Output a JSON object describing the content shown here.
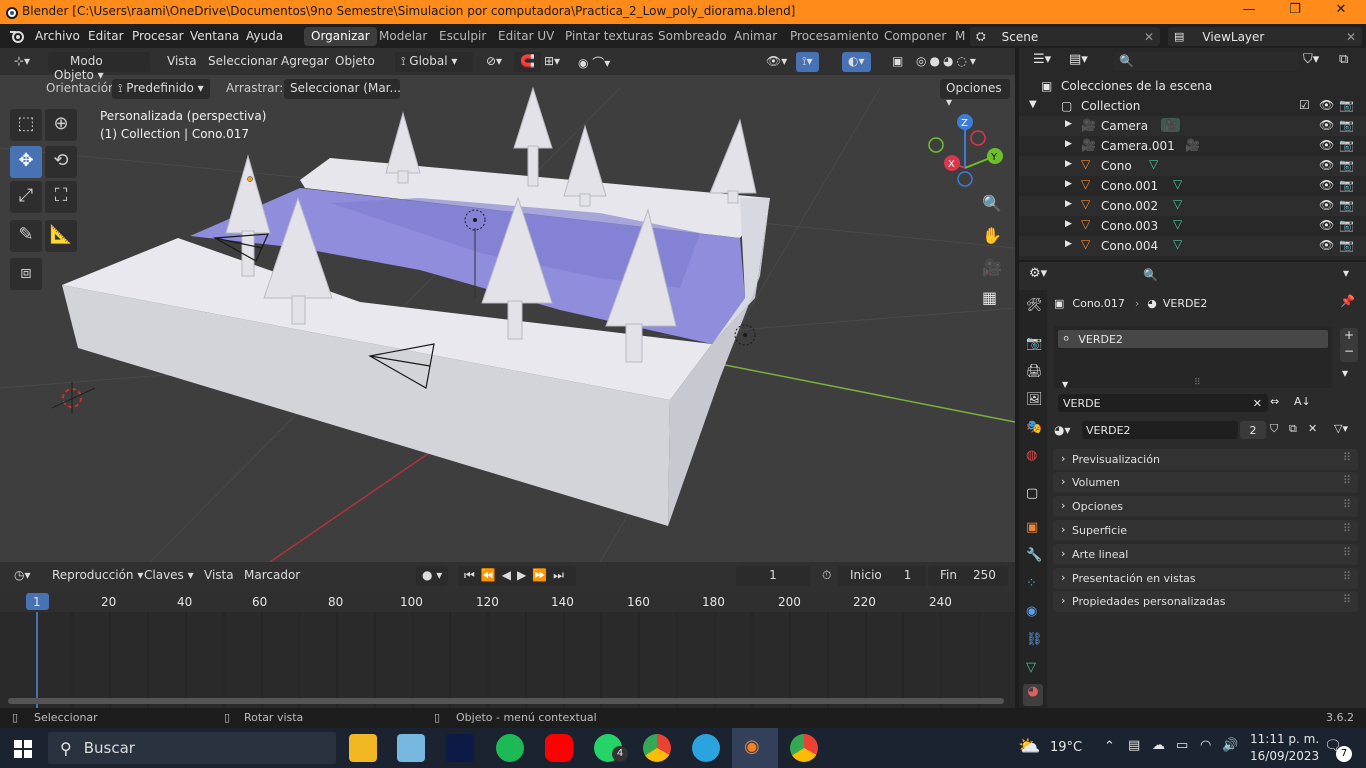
{
  "window": {
    "title": "Blender [C:\\Users\\raami\\OneDrive\\Documentos\\9no Semestre\\Simulacion por computadora\\Practica_2_Low_poly_diorama.blend]"
  },
  "menu": {
    "items": [
      "Archivo",
      "Editar",
      "Procesar",
      "Ventana",
      "Ayuda"
    ]
  },
  "workspaces": [
    "Organizar",
    "Modelar",
    "Esculpir",
    "Editar UV",
    "Pintar texturas",
    "Sombreado",
    "Animar",
    "Procesamiento",
    "Componer",
    "M"
  ],
  "scene": {
    "name": "Scene",
    "view_layer": "ViewLayer"
  },
  "viewport_header": {
    "mode": "Modo Objeto",
    "menus": [
      "Vista",
      "Seleccionar",
      "Agregar",
      "Objeto"
    ],
    "transform_space": "Global",
    "orientation_label": "Orientación:",
    "orientation_value": "Predefinido",
    "drag_label": "Arrastrar:",
    "drag_value": "Seleccionar (Mar...",
    "options": "Opciones"
  },
  "viewport": {
    "view_name": "Personalizada (perspectiva)",
    "context": "(1) Collection | Cono.017"
  },
  "timeline": {
    "playback": "Reproducción",
    "keys": "Claves",
    "view": "Vista",
    "marker": "Marcador",
    "current_frame": "1",
    "start_label": "Inicio",
    "start": "1",
    "end_label": "Fin",
    "end": "250",
    "ruler": [
      "1",
      "20",
      "40",
      "60",
      "80",
      "100",
      "120",
      "140",
      "160",
      "180",
      "200",
      "220",
      "240"
    ]
  },
  "status": {
    "select": "Seleccionar",
    "rotate": "Rotar vista",
    "context_menu": "Objeto - menú contextual",
    "version": "3.6.2"
  },
  "outliner": {
    "scene_collection": "Colecciones de la escena",
    "collection": "Collection",
    "items": [
      {
        "name": "Camera",
        "type": "camera"
      },
      {
        "name": "Camera.001",
        "type": "camera"
      },
      {
        "name": "Cono",
        "type": "mesh"
      },
      {
        "name": "Cono.001",
        "type": "mesh"
      },
      {
        "name": "Cono.002",
        "type": "mesh"
      },
      {
        "name": "Cono.003",
        "type": "mesh"
      },
      {
        "name": "Cono.004",
        "type": "mesh"
      }
    ]
  },
  "properties": {
    "breadcrumb_object": "Cono.017",
    "breadcrumb_material": "VERDE2",
    "slot": "VERDE2",
    "filter": "VERDE",
    "material_name": "VERDE2",
    "users": "2",
    "panels": [
      "Previsualización",
      "Volumen",
      "Opciones",
      "Superficie",
      "Arte lineal",
      "Presentación en vistas",
      "Propiedades personalizadas"
    ]
  },
  "taskbar": {
    "search": "Buscar",
    "whatsapp_badge": "4",
    "temperature": "19°C",
    "time": "11:11 p. m.",
    "date": "16/09/2023",
    "notif_badge": "7"
  },
  "colors": {
    "accent": "#4772b3",
    "title_bar": "#ff8c1a",
    "water": "#8f8ddc",
    "snow": "#e8e8ee"
  }
}
